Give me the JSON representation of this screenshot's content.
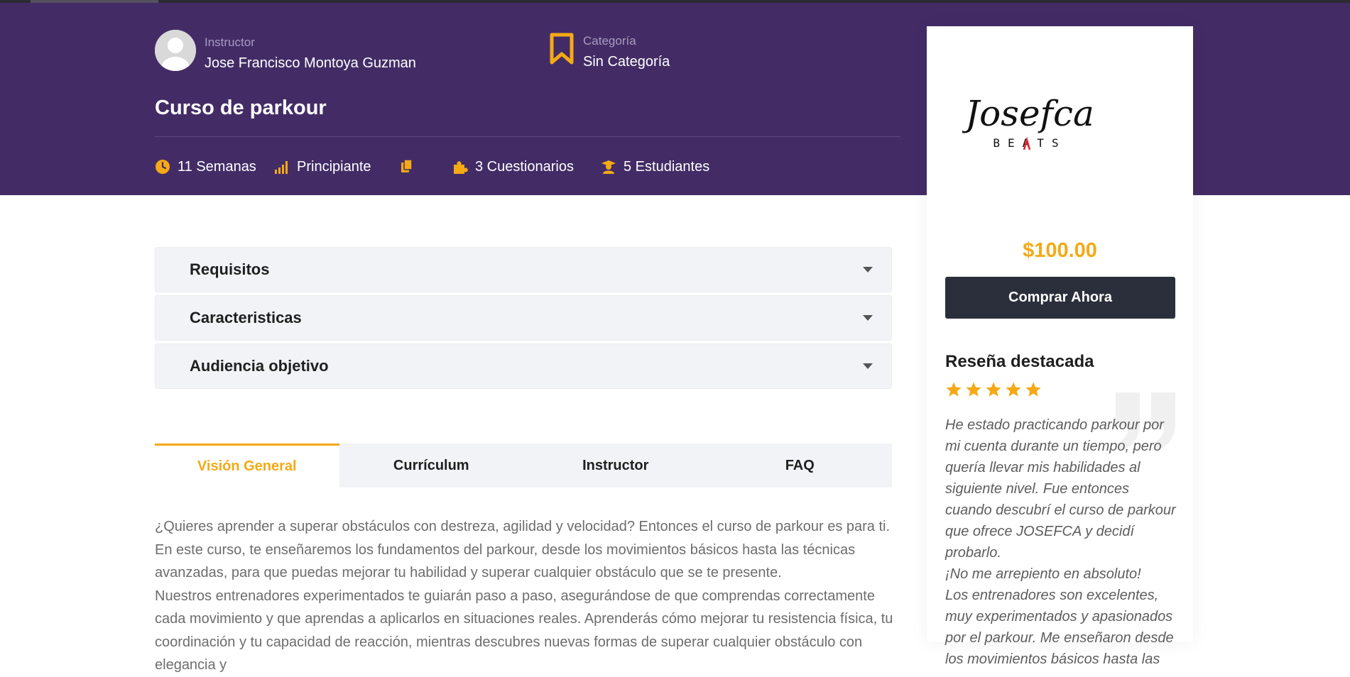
{
  "colors": {
    "hero_bg": "#432c66",
    "accent": "#f5a915",
    "button_bg": "#2a2f3b"
  },
  "instructor": {
    "label": "Instructor",
    "name": "Jose Francisco Montoya Guzman"
  },
  "category": {
    "label": "Categoría",
    "name": "Sin Categoría"
  },
  "course": {
    "title": "Curso de parkour"
  },
  "meta": {
    "duration": "11 Semanas",
    "level": "Principiante",
    "quizzes": "3 Cuestionarios",
    "students": "5 Estudiantes"
  },
  "icons": [
    "user-avatar-icon",
    "bookmark-icon",
    "clock-icon",
    "signal-bars-icon",
    "copy-icon",
    "puzzle-icon",
    "graduate-icon",
    "star-icon",
    "quote-icon",
    "caret-down-icon"
  ],
  "logo": {
    "text": "Josefca",
    "subtext": "BEATS"
  },
  "card": {
    "price": "$100.00",
    "buy_label": "Comprar Ahora",
    "review_title": "Reseña destacada",
    "rating": 5
  },
  "review": {
    "paragraphs": [
      "He estado practicando parkour por mi cuenta durante un tiempo, pero quería llevar mis habilidades al siguiente nivel. Fue entonces cuando descubrí el curso de parkour que ofrece JOSEFCA y decidí probarlo.",
      "¡No me arrepiento en absoluto!",
      "Los entrenadores son excelentes, muy experimentados y apasionados por el parkour. Me enseñaron desde los movimientos básicos hasta las"
    ]
  },
  "accordion": [
    {
      "label": "Requisitos"
    },
    {
      "label": "Caracteristicas"
    },
    {
      "label": "Audiencia objetivo"
    }
  ],
  "tabs": [
    {
      "label": "Visión General"
    },
    {
      "label": "Currículum"
    },
    {
      "label": "Instructor"
    },
    {
      "label": "FAQ"
    }
  ],
  "overview": {
    "paragraphs": [
      "¿Quieres aprender a superar obstáculos con destreza, agilidad y velocidad? Entonces el curso de parkour es para ti. En este curso, te enseñaremos los fundamentos del parkour, desde los movimientos básicos hasta las técnicas avanzadas, para que puedas mejorar tu habilidad y superar cualquier obstáculo que se te presente.",
      "Nuestros entrenadores experimentados te guiarán paso a paso, asegurándose de que comprendas correctamente cada movimiento y que aprendas a aplicarlos en situaciones reales. Aprenderás cómo mejorar tu resistencia física, tu coordinación y tu capacidad de reacción, mientras descubres nuevas formas de superar cualquier obstáculo con elegancia y"
    ]
  }
}
